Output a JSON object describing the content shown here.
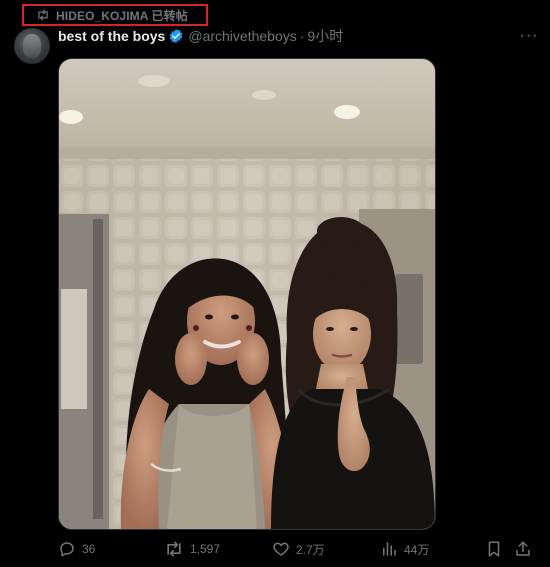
{
  "repost": {
    "label": "HIDEO_KOJIMA 已转帖",
    "icon": "repost-icon",
    "highlight_color": "#d7262b"
  },
  "post": {
    "display_name": "best of the boys",
    "verified": true,
    "verified_color": "#1d9bf0",
    "handle": "@archivetheboys",
    "separator": "·",
    "time": "9小时",
    "more_icon": "more-icon",
    "more_label": "···"
  },
  "media": {
    "kind": "photo"
  },
  "actions": {
    "reply": {
      "icon": "reply-icon",
      "count": "36"
    },
    "repost": {
      "icon": "repost-icon",
      "count": "1,597"
    },
    "like": {
      "icon": "heart-icon",
      "count": "2.7万"
    },
    "views": {
      "icon": "views-icon",
      "count": "44万"
    },
    "bookmark": {
      "icon": "bookmark-icon"
    },
    "share": {
      "icon": "share-icon"
    }
  },
  "colors": {
    "background": "#000000",
    "text": "#e7e9ea",
    "muted": "#71767b"
  }
}
